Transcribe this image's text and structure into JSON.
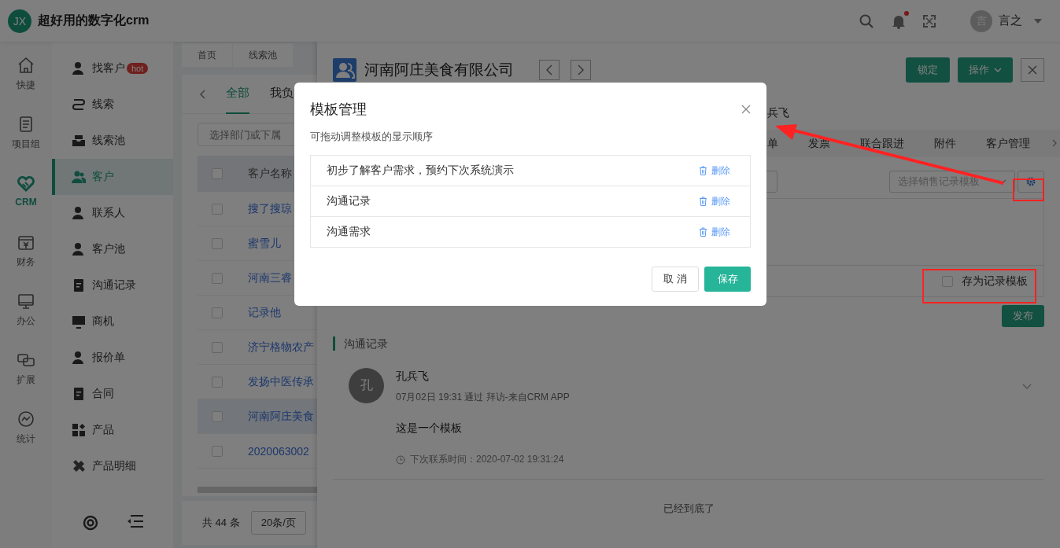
{
  "app": {
    "logo": "JX",
    "title": "超好用的数字化crm"
  },
  "header": {
    "notification_dot": true,
    "user": {
      "avatar": "言",
      "name": "言之"
    }
  },
  "rail": [
    {
      "label": "快捷",
      "selected": false
    },
    {
      "label": "项目组",
      "selected": false
    },
    {
      "label": "CRM",
      "selected": true
    },
    {
      "label": "财务",
      "selected": false
    },
    {
      "label": "办公",
      "selected": false
    },
    {
      "label": "扩展",
      "selected": false
    },
    {
      "label": "统计",
      "selected": false
    }
  ],
  "sidebar": [
    {
      "label": "找客户",
      "badge": "hot",
      "selected": false
    },
    {
      "label": "线索",
      "selected": false
    },
    {
      "label": "线索池",
      "selected": false
    },
    {
      "label": "客户",
      "selected": true
    },
    {
      "label": "联系人",
      "selected": false
    },
    {
      "label": "客户池",
      "selected": false
    },
    {
      "label": "沟通记录",
      "selected": false
    },
    {
      "label": "商机",
      "selected": false
    },
    {
      "label": "报价单",
      "selected": false
    },
    {
      "label": "合同",
      "selected": false
    },
    {
      "label": "产品",
      "selected": false
    },
    {
      "label": "产品明细",
      "selected": false
    }
  ],
  "page_tabs": [
    {
      "label": "首页"
    },
    {
      "label": "线索池"
    }
  ],
  "list": {
    "tabs": [
      {
        "label": "全部",
        "selected": true
      },
      {
        "label": "我负",
        "selected": false
      }
    ],
    "filter_placeholder": "选择部门或下属",
    "select_all_checked": false,
    "column": "客户名称",
    "rows": [
      {
        "name": "搜了搜琼",
        "checked": false,
        "selected": false
      },
      {
        "name": "蜜雪儿",
        "checked": false,
        "selected": false
      },
      {
        "name": "河南三睿",
        "checked": false,
        "selected": false
      },
      {
        "name": "记录他",
        "checked": false,
        "selected": false
      },
      {
        "name": "济宁格物农产",
        "checked": false,
        "selected": false
      },
      {
        "name": "发扬中医传承",
        "checked": false,
        "selected": false
      },
      {
        "name": "河南阿庄美食",
        "checked": false,
        "selected": true
      },
      {
        "name": "2020063002",
        "checked": false,
        "selected": false
      }
    ],
    "total": "共 44 条",
    "page_size": "20条/页"
  },
  "drawer": {
    "title": "河南阿庄美食有限公司",
    "lock_button": "锁定",
    "action_button": "操作",
    "owner": "兵飞",
    "tabs": [
      {
        "label": "单",
        "selected": false
      },
      {
        "label": "发票",
        "selected": false
      },
      {
        "label": "联合跟进",
        "selected": false
      },
      {
        "label": "附件",
        "selected": false
      },
      {
        "label": "客户管理",
        "selected": false
      }
    ],
    "template_placeholder": "选择销售记录模板",
    "save_as_template": {
      "label": "存为记录模板",
      "checked": false
    },
    "publish": "发布",
    "section": "沟通记录",
    "records": [
      {
        "avatar": "孔",
        "name": "孔兵飞",
        "meta": "07月02日 19:31 通过 拜访-来自CRM APP",
        "content": "这是一个模板",
        "next_contact": "下次联系时间：2020-07-02 19:31:24"
      }
    ],
    "end_text": "已经到底了"
  },
  "modal": {
    "title": "模板管理",
    "hint": "可拖动调整模板的显示顺序",
    "templates": [
      {
        "name": "初步了解客户需求，预约下次系统演示",
        "action": "删除"
      },
      {
        "name": "沟通记录",
        "action": "删除"
      },
      {
        "name": "沟通需求",
        "action": "删除"
      }
    ],
    "cancel": "取 消",
    "save": "保存"
  }
}
